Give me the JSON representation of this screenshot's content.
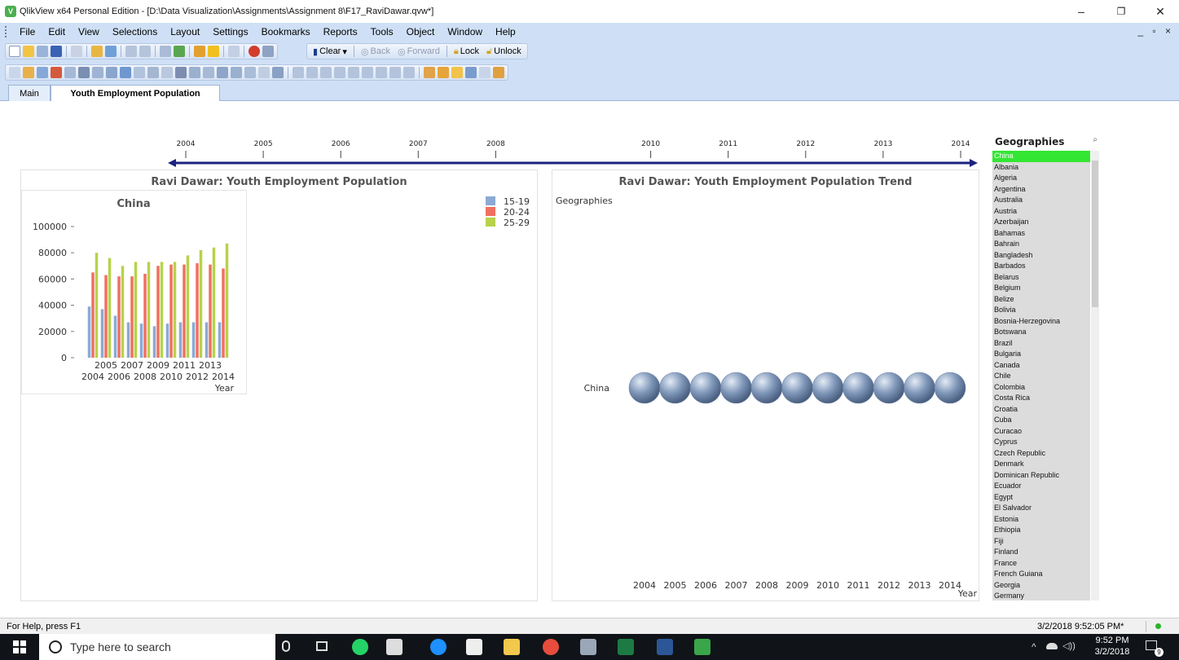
{
  "window": {
    "title": "QlikView x64 Personal Edition - [D:\\Data Visualization\\Assignments\\Assignment 8\\F17_RaviDawar.qvw*]",
    "app_icon": "V",
    "minimize": "–",
    "maximize": "❐",
    "close": "✕"
  },
  "menu": [
    "File",
    "Edit",
    "View",
    "Selections",
    "Layout",
    "Settings",
    "Bookmarks",
    "Reports",
    "Tools",
    "Object",
    "Window",
    "Help"
  ],
  "mdi_controls": "_ ▫ ×",
  "toolbar": {
    "clear": "Clear",
    "back": "Back",
    "forward": "Forward",
    "lock": "Lock",
    "unlock": "Unlock"
  },
  "tabs": [
    {
      "label": "Main",
      "active": false
    },
    {
      "label": "Youth Employment Population",
      "active": true
    }
  ],
  "slider": {
    "years": [
      "2004",
      "2005",
      "2006",
      "2007",
      "2008",
      "2010",
      "2011",
      "2012",
      "2013",
      "2014"
    ],
    "color": "#1a237e"
  },
  "chart_data": [
    {
      "type": "bar",
      "title": "Ravi Dawar: Youth Employment Population",
      "subtitle": "China",
      "xlabel": "Year",
      "ylabel": "",
      "ylim": [
        0,
        100000
      ],
      "yticks": [
        "0",
        "20000",
        "40000",
        "60000",
        "80000",
        "100000"
      ],
      "categories": [
        "2004",
        "2005",
        "2006",
        "2007",
        "2008",
        "2009",
        "2010",
        "2011",
        "2012",
        "2013",
        "2014"
      ],
      "series": [
        {
          "name": "15-19",
          "color": "#8da9d3",
          "values": [
            39000,
            37000,
            32000,
            27000,
            26000,
            24000,
            26000,
            27000,
            27000,
            27000,
            27000
          ]
        },
        {
          "name": "20-24",
          "color": "#f07060",
          "values": [
            65000,
            63000,
            62000,
            62000,
            64000,
            70000,
            71000,
            71000,
            72000,
            71000,
            68000
          ]
        },
        {
          "name": "25-29",
          "color": "#b8d24b",
          "values": [
            80000,
            76000,
            70000,
            73000,
            73000,
            73000,
            73000,
            78000,
            82000,
            84000,
            87000
          ]
        }
      ],
      "legend": "top-right",
      "grid": false
    },
    {
      "type": "scatter",
      "title": "Ravi Dawar: Youth Employment Population Trend",
      "ylabel": "Geographies",
      "xlabel": "Year",
      "categories": [
        "2004",
        "2005",
        "2006",
        "2007",
        "2008",
        "2009",
        "2010",
        "2011",
        "2012",
        "2013",
        "2014"
      ],
      "rows": [
        "China"
      ],
      "marker": "sphere",
      "marker_color": "#7e96b8"
    }
  ],
  "listbox": {
    "title": "Geographies",
    "search_icon": "⌕",
    "items": [
      "China",
      "Albania",
      "Algeria",
      "Argentina",
      "Australia",
      "Austria",
      "Azerbaijan",
      "Bahamas",
      "Bahrain",
      "Bangladesh",
      "Barbados",
      "Belarus",
      "Belgium",
      "Belize",
      "Bolivia",
      "Bosnia-Herzegovina",
      "Botswana",
      "Brazil",
      "Bulgaria",
      "Canada",
      "Chile",
      "Colombia",
      "Costa Rica",
      "Croatia",
      "Cuba",
      "Curacao",
      "Cyprus",
      "Czech Republic",
      "Denmark",
      "Dominican Republic",
      "Ecuador",
      "Egypt",
      "El Salvador",
      "Estonia",
      "Ethiopia",
      "Fiji",
      "Finland",
      "France",
      "French Guiana",
      "Georgia",
      "Germany"
    ],
    "selected": "China",
    "selected_color": "#33e633"
  },
  "status": {
    "help": "For Help, press F1",
    "datetime": "3/2/2018 9:52:05 PM*"
  },
  "taskbar": {
    "search_placeholder": "Type here to search",
    "time": "9:52 PM",
    "date": "3/2/2018",
    "notifications": "9"
  }
}
